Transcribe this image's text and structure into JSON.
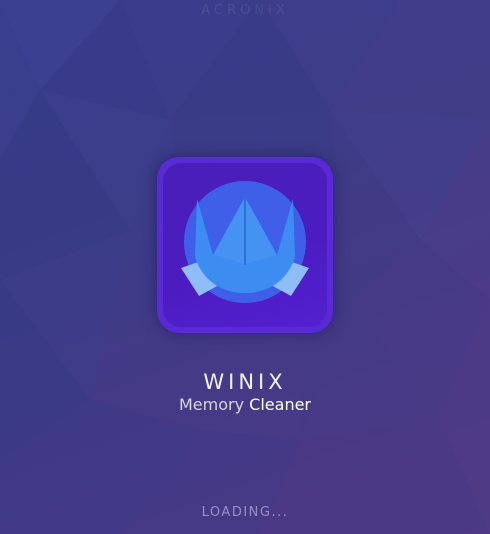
{
  "splash": {
    "watermark": "ACRONIX",
    "app_name": "WINIX",
    "subtitle_part1": "Memory",
    "subtitle_part2": "Cleaner",
    "loading_text": "LOADING...",
    "logo_icon": "winix-crown-logo-icon"
  },
  "colors": {
    "background_start": "#3a3d8f",
    "background_end": "#4f3a86",
    "icon_frame": "#5a2ad6",
    "icon_tile": "#4b1cc0",
    "logo_circle": "#3f5fe8",
    "logo_blue": "#3d8cf2",
    "logo_light": "#8fbdf8"
  }
}
